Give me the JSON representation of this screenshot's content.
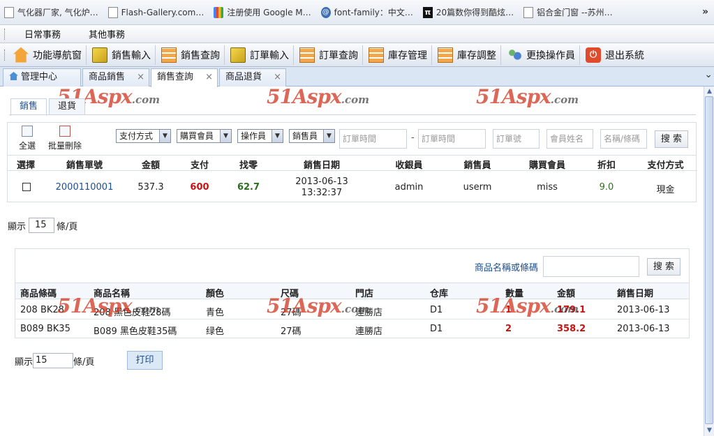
{
  "bookmarks": [
    {
      "label": "气化器厂家, 气化炉…",
      "icon": "page-icon"
    },
    {
      "label": "Flash-Gallery.com…",
      "icon": "page-icon"
    },
    {
      "label": "注册使用 Google M…",
      "icon": "google-icon"
    },
    {
      "label": "font-family：中文…",
      "icon": "at-icon"
    },
    {
      "label": "20篇数你得到酷炫…",
      "icon": "pi-icon"
    },
    {
      "label": "铝合金门窗 --苏州…",
      "icon": "page-icon"
    }
  ],
  "bookmarks_more": "»",
  "menu": [
    "日常事務",
    "其他事務"
  ],
  "toolbar": [
    {
      "label": "功能導航窗",
      "icon": "home-icon"
    },
    {
      "label": "銷售輸入",
      "icon": "edit-icon"
    },
    {
      "label": "銷售查詢",
      "icon": "grid-icon"
    },
    {
      "label": "訂單輸入",
      "icon": "edit-icon"
    },
    {
      "label": "訂單查詢",
      "icon": "grid-icon"
    },
    {
      "label": "庫存管理",
      "icon": "grid-icon"
    },
    {
      "label": "庫存調整",
      "icon": "grid-icon"
    },
    {
      "label": "更換操作員",
      "icon": "user-icon"
    },
    {
      "label": "退出系統",
      "icon": "exit-icon"
    }
  ],
  "tabs": [
    {
      "label": "管理中心",
      "closable": false
    },
    {
      "label": "商品銷售",
      "closable": true
    },
    {
      "label": "銷售查詢",
      "closable": true,
      "active": true
    },
    {
      "label": "商品退貨",
      "closable": true
    }
  ],
  "tab_close": "×",
  "watermark": {
    "brand": "51Aspx",
    "domain": ".com"
  },
  "subtabs": {
    "sales": "銷售",
    "returns": "退貨"
  },
  "filter": {
    "select_all": "全選",
    "batch_delete": "批量刪除",
    "payment_method": "支付方式",
    "member": "購買會員",
    "operator": "操作員",
    "salesperson": "銷售員",
    "order_time_from": "訂單時間",
    "range_sep": "-",
    "order_time_to": "訂單時間",
    "order_no": "訂單號",
    "member_name": "會員姓名",
    "name_barcode": "名稱/條碼",
    "search": "搜 索"
  },
  "sales_table": {
    "headers": [
      "選擇",
      "銷售單號",
      "金額",
      "支付",
      "找零",
      "銷售日期",
      "收銀員",
      "銷售員",
      "購買會員",
      "折扣",
      "支付方式"
    ],
    "rows": [
      {
        "order_no": "2000110001",
        "amount": "537.3",
        "paid": "600",
        "change": "62.7",
        "date": "2013-06-13",
        "time": "13:32:37",
        "cashier": "admin",
        "salesperson": "userm",
        "member": "miss",
        "discount": "9.0",
        "payment": "現金"
      }
    ]
  },
  "pager1": {
    "prefix": "顯示",
    "value": "15",
    "suffix": "條/頁"
  },
  "detail": {
    "search_label": "商品名稱或條碼",
    "search_value": "",
    "search_button": "搜 索",
    "headers": [
      "商品條碼",
      "商品名稱",
      "顏色",
      "尺碼",
      "門店",
      "仓库",
      "數量",
      "金額",
      "銷售日期"
    ],
    "rows": [
      {
        "barcode": "208 BK28",
        "name": "208 黑色皮鞋28碼",
        "color": "青色",
        "size": "27碼",
        "store": "連勝店",
        "warehouse": "D1",
        "qty": "1",
        "amount": "179.1",
        "date": "2013-06-13"
      },
      {
        "barcode": "B089 BK35",
        "name": "B089 黑色皮鞋35碼",
        "color": "绿色",
        "size": "27碼",
        "store": "連勝店",
        "warehouse": "D1",
        "qty": "2",
        "amount": "358.2",
        "date": "2013-06-13"
      }
    ]
  },
  "pager2": {
    "prefix": "顯示",
    "value": "15",
    "suffix": "條/頁"
  },
  "print_button": "打印",
  "colors": {
    "red": "#cc1111",
    "green": "#2e6e1e",
    "link": "#1c4f91"
  }
}
